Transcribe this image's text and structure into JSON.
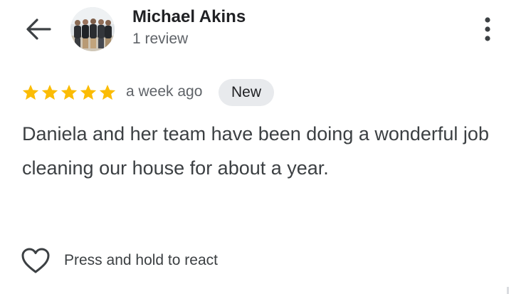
{
  "header": {
    "reviewer_name": "Michael Akins",
    "review_count": "1 review",
    "back_icon": "arrow-left-icon",
    "more_icon": "more-vertical-icon"
  },
  "review": {
    "rating": 5,
    "max_rating": 5,
    "star_color": "#fbbc04",
    "time_ago": "a week ago",
    "badge": "New",
    "text": "Daniela and her team have been doing a wonderful job cleaning our house for about a year."
  },
  "react": {
    "icon": "heart-outline-icon",
    "label": "Press and hold to react"
  }
}
